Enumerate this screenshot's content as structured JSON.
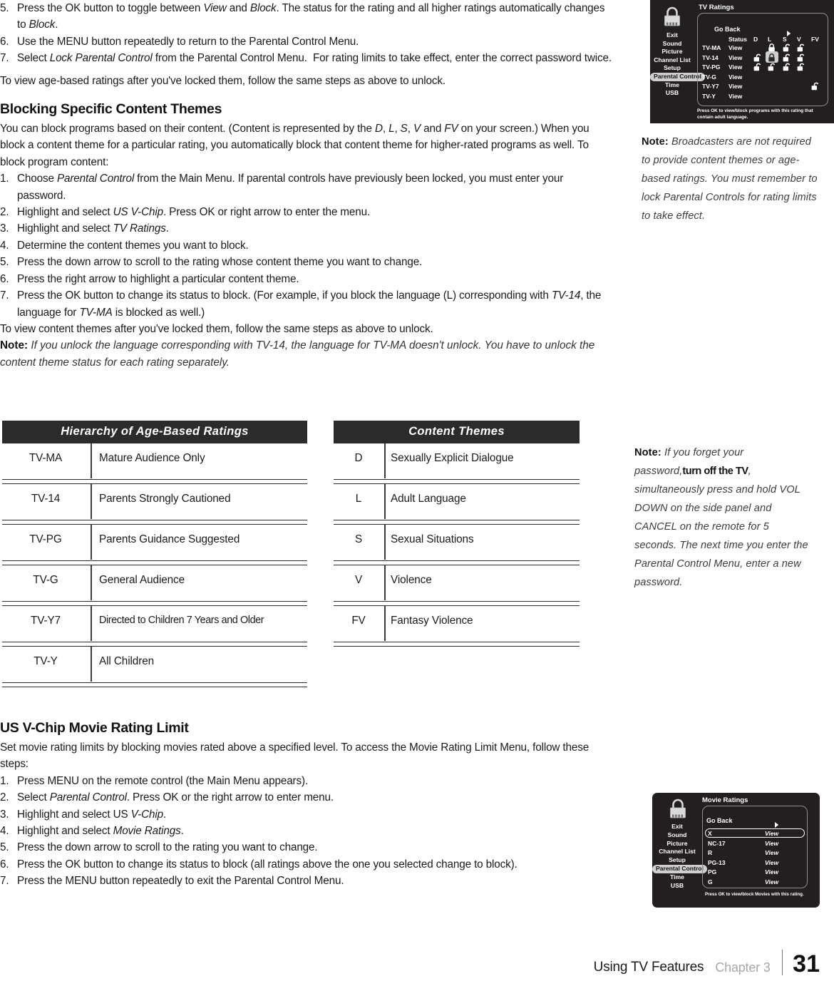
{
  "document": {
    "footer": {
      "title": "Using TV Features",
      "chapter": "Chapter 3",
      "page": "31"
    }
  },
  "top_steps": [
    {
      "num": "5.",
      "html": "Press the OK button to toggle between <i>View</i> and <i>Block</i>. The status for the rating and all higher ratings automatically changes to <i>Block</i>."
    },
    {
      "num": "6.",
      "html": "Use the MENU button repeatedly to return to the Parental Control Menu."
    },
    {
      "num": "7.",
      "html": "Select <i>Lock Parental Control</i> from the Parental Control Menu.&nbsp; For rating limits to take effect, enter the correct password twice."
    }
  ],
  "top_closing": "To view age-based ratings after you've locked them, follow the same steps as above to unlock.",
  "section_themes": {
    "heading": "Blocking Specific Content Themes",
    "intro": "You can block programs based on their content. (Content is represented by the <i>D</i>, <i>L</i>, <i>S</i>, <i>V</i> and <i>FV</i> on your screen.) When you block a content theme for a particular rating, you automatically block that content theme for higher-rated programs as well. To block program content:",
    "steps": [
      {
        "num": "1.",
        "html": "Choose <i>Parental Control</i> from the Main Menu. If parental controls have previously been locked, you must enter your password."
      },
      {
        "num": "2.",
        "html": "Highlight and select <i>US V-Chip</i>. Press OK or right arrow to enter the menu."
      },
      {
        "num": "3.",
        "html": "Highlight and select <i>TV Ratings</i>."
      },
      {
        "num": "4.",
        "html": "Determine the content themes you want to block."
      },
      {
        "num": "5.",
        "html": "Press the down arrow to scroll to the rating whose content theme you want to change."
      },
      {
        "num": "6.",
        "html": "Press the right arrow to highlight a particular content theme."
      },
      {
        "num": "7.",
        "html": "Press the OK button to change its status to block. (For example, if you block the language (L) corresponding with <i>TV-14</i>, the language for <i>TV-MA</i> is blocked as well.)"
      }
    ],
    "closing": "To view content themes after you've locked them, follow the same steps as above to unlock.",
    "note_label": "Note:",
    "note_text": "If you unlock the language corresponding with TV-14, the language for TV-MA doesn't unlock. You have to unlock the content theme status for each rating separately."
  },
  "table_age": {
    "header": "Hierarchy of Age-Based Ratings",
    "rows": [
      {
        "key": "TV-MA",
        "value": "Mature Audience Only"
      },
      {
        "key": "TV-14",
        "value": "Parents Strongly Cautioned"
      },
      {
        "key": "TV-PG",
        "value": "Parents Guidance Suggested"
      },
      {
        "key": "TV-G",
        "value": "General Audience"
      },
      {
        "key": "TV-Y7",
        "value": "Directed to Children 7 Years and Older"
      },
      {
        "key": "TV-Y",
        "value": "All Children"
      }
    ]
  },
  "table_themes": {
    "header": "Content Themes",
    "rows": [
      {
        "key": "D",
        "value": "Sexually Explicit Dialogue"
      },
      {
        "key": "L",
        "value": "Adult Language"
      },
      {
        "key": "S",
        "value": "Sexual Situations"
      },
      {
        "key": "V",
        "value": "Violence"
      },
      {
        "key": "FV",
        "value": "Fantasy Violence"
      }
    ]
  },
  "section_movie": {
    "heading": "US V-Chip Movie Rating Limit",
    "intro": "Set movie rating limits by blocking movies rated above a specified level. To access the Movie Rating Limit Menu, follow these steps:",
    "steps": [
      {
        "num": "1.",
        "html": "Press MENU on the remote control (the Main Menu appears)."
      },
      {
        "num": "2.",
        "html": "Select <i>Parental Control</i>. Press OK or the right arrow to enter menu."
      },
      {
        "num": "3.",
        "html": "Highlight and select US <i>V-Chip</i>."
      },
      {
        "num": "4.",
        "html": "Highlight and select <i>Movie Ratings</i>."
      },
      {
        "num": "5.",
        "html": "Press the down arrow to scroll to the rating you want to change."
      },
      {
        "num": "6.",
        "html": "Press the OK button to change its status to block (all ratings above the one you selected change to block)."
      },
      {
        "num": "7.",
        "html": "Press the MENU button repeatedly to exit the Parental Control Menu."
      }
    ]
  },
  "notes": {
    "broadcasters": {
      "label": "Note:",
      "text": "Broadcasters are not required to provide content themes or age-based ratings. You must remember to lock Parental Controls for rating limits to take effect."
    },
    "password": {
      "label": "Note:",
      "text_before": "If you forget your password,",
      "emphasis": "turn off the TV",
      "text_after": ", simultaneously press and hold VOL DOWN on the side panel and CANCEL on the remote for 5 seconds. The next time you enter the Parental Control Menu, enter a new password."
    }
  },
  "osd_tv_ratings": {
    "title": "TV Ratings",
    "menu": [
      "Exit",
      "Sound",
      "Picture",
      "Channel List",
      "Setup",
      "Parental Control",
      "Time",
      "USB"
    ],
    "selected_menu": "Parental Control",
    "go_back": "Go Back",
    "columns": [
      "Status",
      "D",
      "L",
      "S",
      "V",
      "FV"
    ],
    "rows": [
      {
        "rating": "TV-MA",
        "status": "View",
        "locks": {
          "D": "",
          "L": "closed",
          "S": "open",
          "V": "open",
          "FV": ""
        }
      },
      {
        "rating": "TV-14",
        "status": "View",
        "locks": {
          "D": "open",
          "L": "closed-highlighted",
          "S": "open",
          "V": "open",
          "FV": ""
        }
      },
      {
        "rating": "TV-PG",
        "status": "View",
        "locks": {
          "D": "open",
          "L": "open",
          "S": "open",
          "V": "open",
          "FV": ""
        }
      },
      {
        "rating": "TV-G",
        "status": "View",
        "locks": {
          "D": "",
          "L": "",
          "S": "",
          "V": "",
          "FV": ""
        }
      },
      {
        "rating": "TV-Y7",
        "status": "View",
        "locks": {
          "D": "",
          "L": "",
          "S": "",
          "V": "",
          "FV": "open"
        }
      },
      {
        "rating": "TV-Y",
        "status": "View",
        "locks": {
          "D": "",
          "L": "",
          "S": "",
          "V": "",
          "FV": ""
        }
      }
    ],
    "footnote": "Press OK to view/block programs with this rating that contain adult language."
  },
  "osd_movie_ratings": {
    "title": "Movie Ratings",
    "menu": [
      "Exit",
      "Sound",
      "Picture",
      "Channel List",
      "Setup",
      "Parental Control",
      "Time",
      "USB"
    ],
    "selected_menu": "Parental Control",
    "go_back": "Go Back",
    "rows": [
      {
        "rating": "X",
        "status": "View",
        "selected": true
      },
      {
        "rating": "NC-17",
        "status": "View",
        "selected": false
      },
      {
        "rating": "R",
        "status": "View",
        "selected": false
      },
      {
        "rating": "PG-13",
        "status": "View",
        "selected": false
      },
      {
        "rating": "PG",
        "status": "View",
        "selected": false
      },
      {
        "rating": "G",
        "status": "View",
        "selected": false
      }
    ],
    "footnote": "Press OK to view/block Movies with this rating."
  }
}
